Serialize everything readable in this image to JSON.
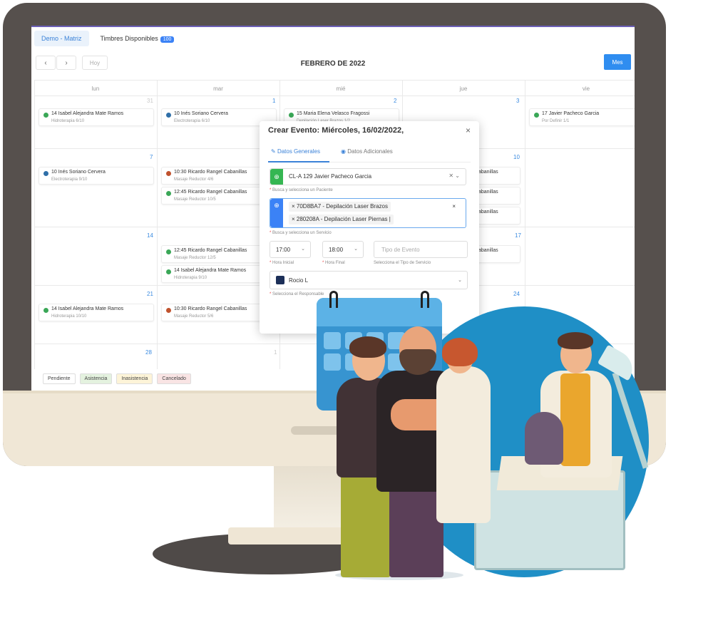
{
  "tabs": [
    {
      "label": "Demo - Matriz"
    },
    {
      "label": "Timbres Disponibles",
      "badge": "100"
    }
  ],
  "toolbar": {
    "prev": "‹",
    "next": "›",
    "today": "Hoy",
    "title": "FEBRERO DE 2022",
    "view": "Mes"
  },
  "days": [
    "lun",
    "mar",
    "mié",
    "jue",
    "vie"
  ],
  "day_numbers": {
    "w1": [
      "31",
      "1",
      "2",
      "3"
    ],
    "w2": [
      "7",
      "10"
    ],
    "w3": [
      "14",
      "17"
    ],
    "w4": [
      "21",
      "24"
    ],
    "w5": [
      "28",
      "1"
    ]
  },
  "events": [
    {
      "title": "14 Isabel Alejandra Mate Ramos",
      "sub": "Hidroterapia 6/10",
      "color": "#3aa757"
    },
    {
      "title": "10 Inés Soriano Cervera",
      "sub": "Electroterapia 6/10",
      "color": "#2f6fa8"
    },
    {
      "title": "15 Maria Elena Velasco Fragossi",
      "sub": "Depilación Laser Brazos 1/2",
      "color": "#3aa757"
    },
    {
      "title": "17 Javier Pacheco Garcia",
      "sub": "Por Definir 1/1",
      "color": "#3aa757"
    },
    {
      "title": "10 Inés Soriano Cervera",
      "sub": "Electroterapia 9/10",
      "color": "#2f6fa8"
    },
    {
      "title": "10:30 Ricardo Rangel Cabanillas",
      "sub": "Masaje Reductor 4/6",
      "color": "#c0522d"
    },
    {
      "title": "12:45 Ricardo Rangel Cabanillas",
      "sub": "Masaje Reductor 10/5",
      "color": "#3aa757"
    },
    {
      "title": "12:45 Ricardo Rangel Cabanillas",
      "sub": "Masaje Reductor 12/5",
      "color": "#3aa757"
    },
    {
      "title": "14 Isabel Alejandra Mate Ramos",
      "sub": "Hidroterapia 9/10",
      "color": "#3aa757"
    },
    {
      "title": "14 Isabel Alejandra Mate Ramos",
      "sub": "Hidroterapia 10/10",
      "color": "#3aa757"
    },
    {
      "title": "10:30 Ricardo Rangel Cabanillas",
      "sub": "Masaje Reductor 5/6",
      "color": "#c0522d"
    }
  ],
  "partial_events": [
    "abanillas",
    "abanillas",
    "abanillas",
    "abanillas"
  ],
  "legend": [
    "Pendiente",
    "Asistencia",
    "Inasistencia",
    "Cancelado"
  ],
  "legend_colors": [
    "#ffffff",
    "#e4f2df",
    "#fdf4d8",
    "#f9e4e4"
  ],
  "modal": {
    "title": "Crear Evento: Miércoles, 16/02/2022,",
    "close": "×",
    "tab_general": "Datos Generales",
    "tab_additional": "Datos Adicionales",
    "patient": "CL-A 129 Javier Pacheco Garcia",
    "patient_help": "Busca y selecciona un Paciente",
    "services": [
      "70D8BA7 - Depilación Laser Brazos",
      "280208A - Depilación Laser Piernas"
    ],
    "service_help": "Busca y selecciona un Servicio",
    "start_time": "17:00",
    "end_time": "18:00",
    "start_label": "Hora Inicial",
    "end_label": "Hora Final",
    "event_type_placeholder": "Tipo de Evento",
    "event_type_help": "Selecciona el Tipo de Servicio",
    "responsible": "Rocio L",
    "responsible_help": "Selecciona el Responsable"
  }
}
